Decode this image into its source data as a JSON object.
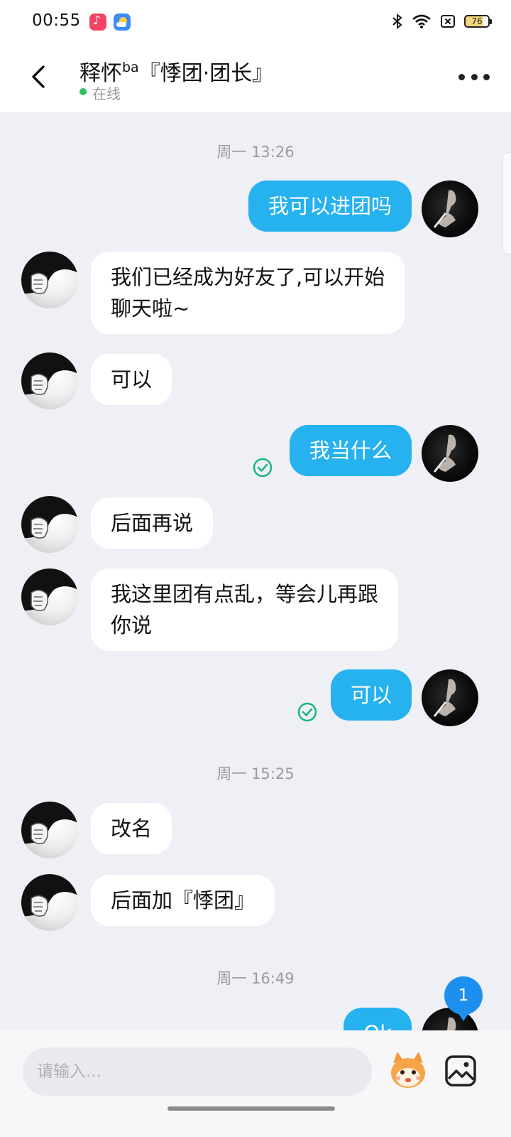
{
  "status_bar": {
    "time": "00:55",
    "battery": "76",
    "icons": [
      "music-app-icon",
      "weather-app-icon",
      "bluetooth-icon",
      "wifi-icon",
      "sim-card-icon",
      "battery-icon"
    ]
  },
  "header": {
    "name": "释怀",
    "name_sup": "ba",
    "name_suffix": "『悸团·团长』",
    "status": "在线",
    "icons": [
      "back-arrow-icon",
      "more-icon"
    ]
  },
  "chat": {
    "timestamps": [
      "周一 13:26",
      "周一 15:25",
      "周一 16:49"
    ],
    "messages": [
      {
        "from": "self",
        "text": "我可以进团吗"
      },
      {
        "from": "other",
        "line1": "我们已经成为好友了,可以开始",
        "line2": "聊天啦~"
      },
      {
        "from": "other",
        "text": "可以"
      },
      {
        "from": "self",
        "text": "我当什么",
        "read": true
      },
      {
        "from": "other",
        "text": "后面再说"
      },
      {
        "from": "other",
        "line1": "我这里团有点乱，等会儿再跟",
        "line2": "你说"
      },
      {
        "from": "self",
        "text": "可以",
        "read": true
      },
      {
        "from": "other",
        "text": "改名"
      },
      {
        "from": "other",
        "text": "后面加『悸团』"
      },
      {
        "from": "self",
        "text": "Ok"
      }
    ],
    "unread_count": "1"
  },
  "input": {
    "placeholder": "请输入...",
    "value": "",
    "icons": [
      "emoji-mascot-icon",
      "image-icon"
    ]
  },
  "colors": {
    "self_bubble": "#26b1ef",
    "other_bubble": "#ffffff",
    "background": "#eff0f5",
    "online": "#2ac25d",
    "read_check": "#18b584",
    "badge": "#1d8fee"
  }
}
